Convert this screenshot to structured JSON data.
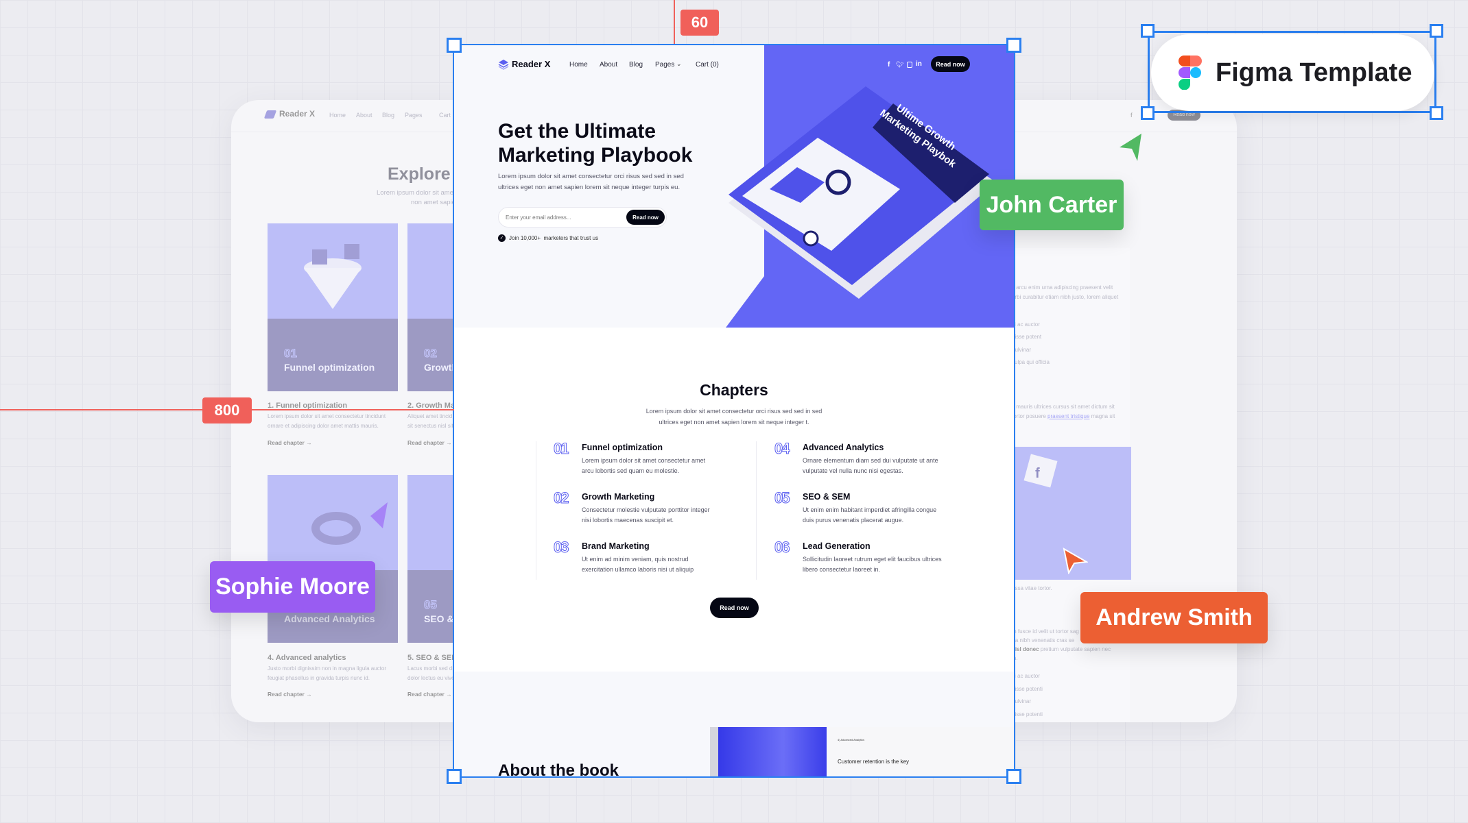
{
  "canvas": {
    "ruler_top": "60",
    "ruler_left": "800",
    "frame_color": "#2a7ff0",
    "guide_color": "#f0605a"
  },
  "figma_badge": {
    "label": "Figma Template"
  },
  "collaborators": [
    {
      "name": "John Carter",
      "color": "#52b963"
    },
    {
      "name": "Sophie Moore",
      "color": "#995cf2"
    },
    {
      "name": "Andrew Smith",
      "color": "#ec5f33"
    }
  ],
  "background_page": {
    "brand": "Reader X",
    "nav": [
      "Home",
      "About",
      "Blog",
      "Pages",
      "Cart ("
    ],
    "cta": "Read now",
    "heading": "Explore t",
    "intro": [
      "Lorem ipsum dolor sit amet con",
      "non amet sapien l"
    ],
    "cards": [
      {
        "num": "01",
        "title": "Funnel optimization",
        "heading": "1. Funnel optimization",
        "desc": [
          "Lorem ipsum dolor sit amet consectetur tincidunt",
          "ornare et adipiscing dolor amet mattis mauris."
        ],
        "link": "Read chapter →"
      },
      {
        "num": "02",
        "title": "Growth",
        "heading": "2. Growth Ma",
        "desc": [
          "Aliquet amet tincid",
          "sit senectus nisl sit"
        ],
        "link": "Read chapter →"
      },
      {
        "num": "04",
        "title": "Advanced Analytics",
        "heading": "4. Advanced analytics",
        "desc": [
          "Justo morbi dignissim non in magna ligula auctor",
          "feugiat phasellus in gravida turpis nunc id."
        ],
        "link": "Read chapter →"
      },
      {
        "num": "05",
        "title": "SEO &",
        "heading": "5. SEO & SEM",
        "desc": [
          "Lacus morbi sed di",
          "dolor lectus eu vive"
        ],
        "link": "Read chapter →"
      }
    ],
    "article_lines": [
      "s arcu enim urna adipiscing praesent velit",
      "orbi curabitur etiam nibh justo, lorem aliquet",
      "ci ac auctor",
      "disse potent",
      "pulvinar",
      "culpa qui officia",
      "s mauris ultrices cursus sit amet dictum sit",
      "tortor posuere",
      "praesent tristique",
      "magna sit",
      "assa vitae tortor.",
      "m fusce id velit ut tortor sag",
      "rta nibh venenatis cras se",
      "nisl donec",
      "pretium vulputate sapien nec",
      "in.",
      "ci ac auctor",
      "disse potenti",
      "pulvinar",
      "disse potenti"
    ]
  },
  "page": {
    "brand": "Reader X",
    "nav": {
      "home": "Home",
      "about": "About",
      "blog": "Blog",
      "pages": "Pages",
      "cart": "Cart (0)"
    },
    "social_icons": [
      "facebook-icon",
      "twitter-icon",
      "instagram-icon",
      "linkedin-icon"
    ],
    "nav_cta": "Read now",
    "hero": {
      "title_line1": "Get the Ultimate",
      "title_line2": "Marketing Playbook",
      "text_line1": "Lorem ipsum dolor sit amet consectetur orci risus sed sed in sed",
      "text_line2": "ultrices eget non amet sapien lorem sit neque integer turpis eu.",
      "email_placeholder": "Enter your email address...",
      "cta": "Read now",
      "trust": "Join 10,000+  marketers that trust us",
      "book_title_line1": "Ultime Growth",
      "book_title_line2": "Marketing Playbok",
      "accent": "#6366f5"
    },
    "chapters": {
      "title": "Chapters",
      "intro_line1": "Lorem ipsum dolor sit amet consectetur orci risus sed sed in sed",
      "intro_line2": "ultrices eget non amet sapien lorem sit neque integer t.",
      "items": [
        {
          "num": "01",
          "title": "Funnel optimization",
          "desc": "Lorem ipsum dolor sit amet consectetur amet arcu lobortis sed quam eu molestie."
        },
        {
          "num": "02",
          "title": "Growth Marketing",
          "desc": "Consectetur molestie vulputate porttitor integer nisi lobortis maecenas suscipit et."
        },
        {
          "num": "03",
          "title": "Brand Marketing",
          "desc": "Ut enim ad minim veniam, quis nostrud exercitation ullamco laboris nisi ut aliquip"
        },
        {
          "num": "04",
          "title": "Advanced Analytics",
          "desc": "Ornare elementum diam sed dui vulputate ut ante vulputate vel nulla nunc nisi egestas."
        },
        {
          "num": "05",
          "title": "SEO & SEM",
          "desc": "Ut enim enim habitant imperdiet afringilla congue duis purus venenatis placerat augue."
        },
        {
          "num": "06",
          "title": "Lead Generation",
          "desc": "Sollicitudin laoreet rutrum eget elit faucibus ultrices libero consectetur laoreet in."
        }
      ],
      "cta": "Read now"
    },
    "about": {
      "title": "About the book",
      "book_chapter": "4) Advanced Analytics",
      "book_heading": "Customer retention is the key"
    }
  }
}
